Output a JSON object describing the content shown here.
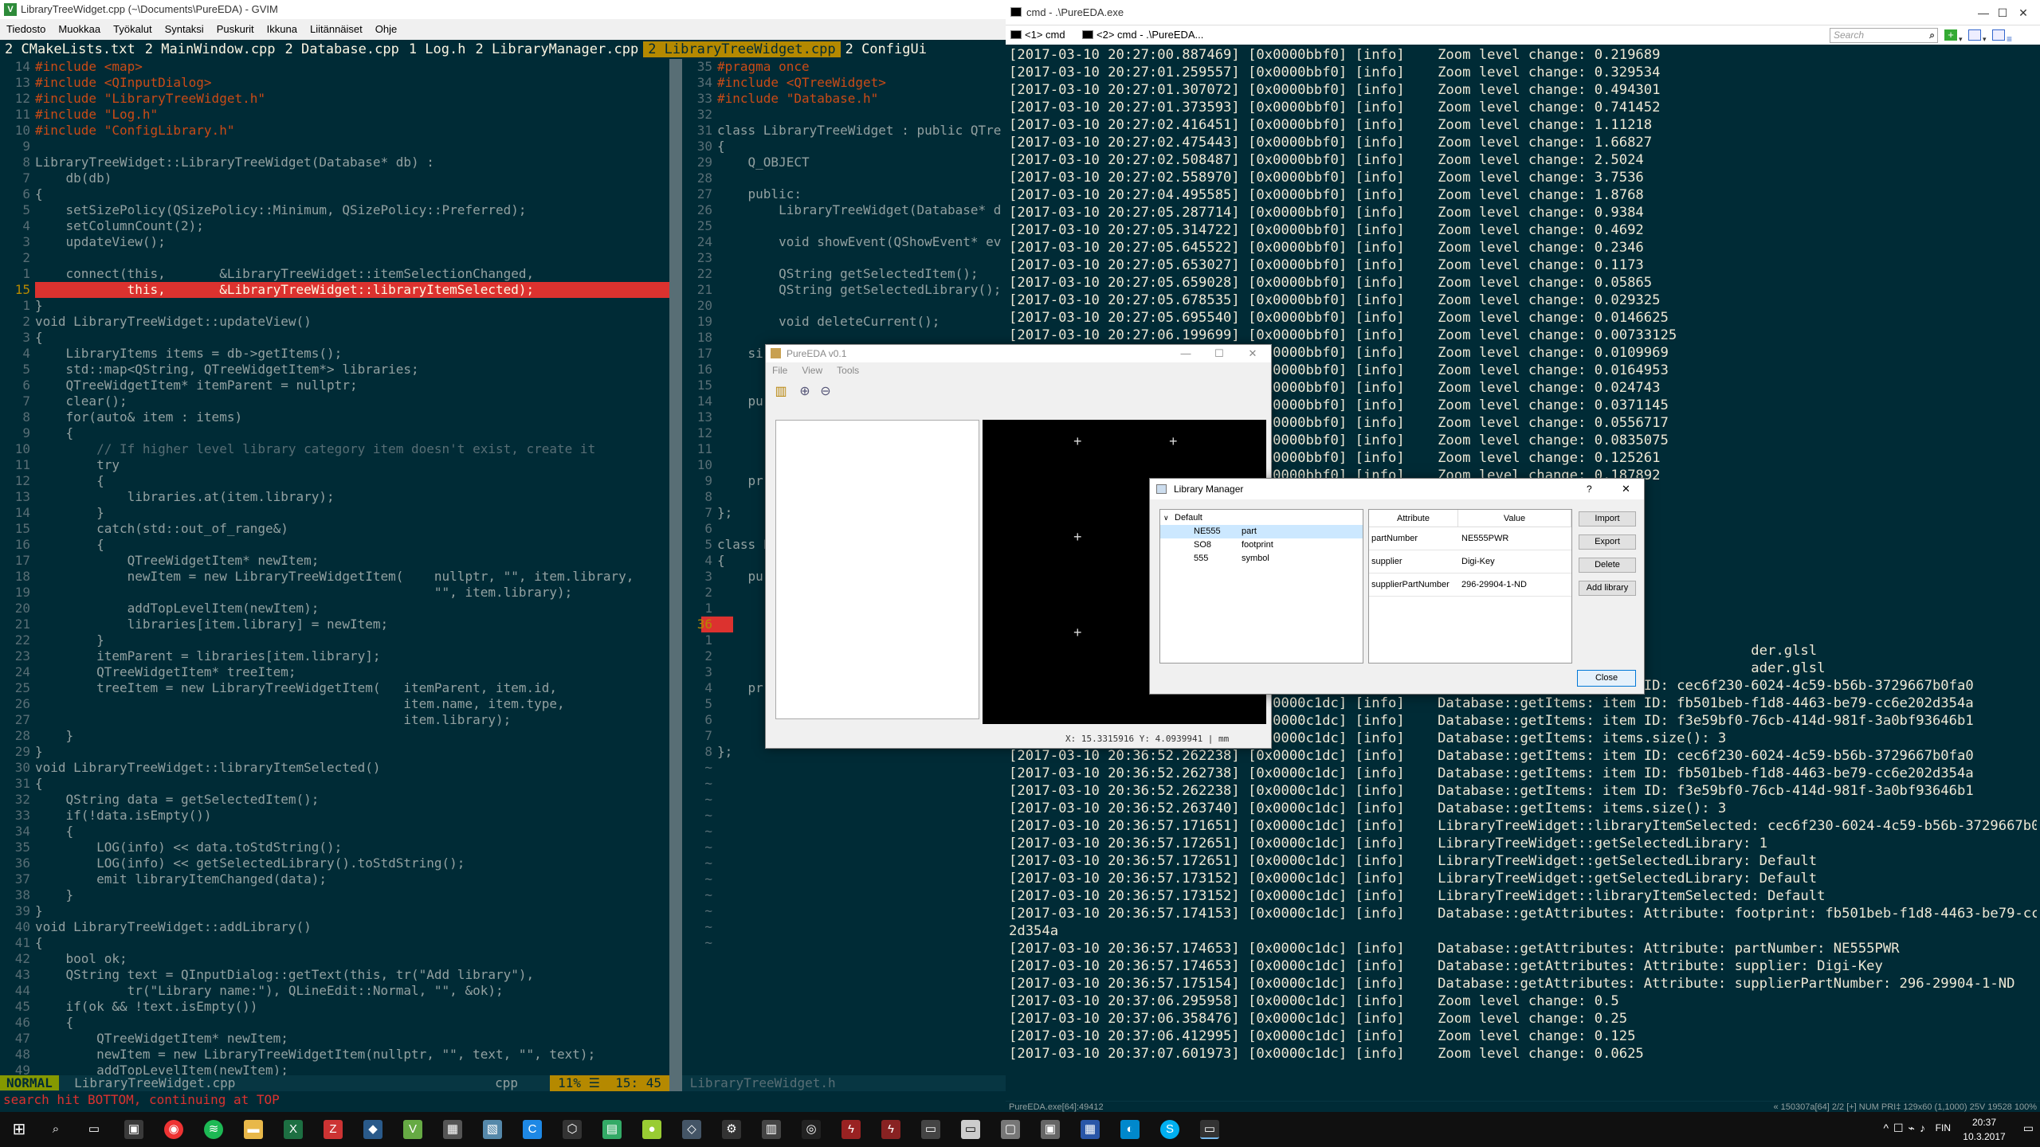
{
  "gvim": {
    "title": "LibraryTreeWidget.cpp (~\\Documents\\PureEDA) - GVIM",
    "menu": [
      "Tiedosto",
      "Muokkaa",
      "Työkalut",
      "Syntaksi",
      "Puskurit",
      "Ikkuna",
      "Liitännäiset",
      "Ohje"
    ],
    "tabs": [
      {
        "label": "2 CMakeLists.txt",
        "active": false
      },
      {
        "label": "2 MainWindow.cpp",
        "active": false
      },
      {
        "label": "2 Database.cpp",
        "active": false
      },
      {
        "label": "1 Log.h",
        "active": false
      },
      {
        "label": "2 LibraryManager.cpp",
        "active": false
      },
      {
        "label": "2 LibraryTreeWidget.cpp",
        "active": true
      },
      {
        "label": "2 ConfigUi",
        "active": false
      }
    ],
    "left_lines": [
      {
        "n": "14",
        "t": "#include <map>"
      },
      {
        "n": "13",
        "t": "#include <QInputDialog>"
      },
      {
        "n": "12",
        "t": "#include \"LibraryTreeWidget.h\""
      },
      {
        "n": "11",
        "t": "#include \"Log.h\""
      },
      {
        "n": "10",
        "t": "#include \"ConfigLibrary.h\""
      },
      {
        "n": "9",
        "t": ""
      },
      {
        "n": "8",
        "t": "LibraryTreeWidget::LibraryTreeWidget(Database* db) :"
      },
      {
        "n": "7",
        "t": "    db(db)"
      },
      {
        "n": "6",
        "t": "{"
      },
      {
        "n": "5",
        "t": "    setSizePolicy(QSizePolicy::Minimum, QSizePolicy::Preferred);"
      },
      {
        "n": "4",
        "t": "    setColumnCount(2);"
      },
      {
        "n": "3",
        "t": "    updateView();"
      },
      {
        "n": "2",
        "t": ""
      },
      {
        "n": "1",
        "t": "    connect(this,       &LibraryTreeWidget::itemSelectionChanged,"
      },
      {
        "n": "15",
        "t": "            this,       &LibraryTreeWidget::libraryItemSelected);",
        "hl": true
      },
      {
        "n": "1",
        "t": "}"
      },
      {
        "n": "2",
        "t": "void LibraryTreeWidget::updateView()"
      },
      {
        "n": "3",
        "t": "{"
      },
      {
        "n": "4",
        "t": "    LibraryItems items = db->getItems();"
      },
      {
        "n": "5",
        "t": "    std::map<QString, QTreeWidgetItem*> libraries;"
      },
      {
        "n": "6",
        "t": "    QTreeWidgetItem* itemParent = nullptr;"
      },
      {
        "n": "7",
        "t": "    clear();"
      },
      {
        "n": "8",
        "t": "    for(auto& item : items)"
      },
      {
        "n": "9",
        "t": "    {"
      },
      {
        "n": "10",
        "t": "        // If higher level library category item doesn't exist, create it"
      },
      {
        "n": "11",
        "t": "        try"
      },
      {
        "n": "12",
        "t": "        {"
      },
      {
        "n": "13",
        "t": "            libraries.at(item.library);"
      },
      {
        "n": "14",
        "t": "        }"
      },
      {
        "n": "15",
        "t": "        catch(std::out_of_range&)"
      },
      {
        "n": "16",
        "t": "        {"
      },
      {
        "n": "17",
        "t": "            QTreeWidgetItem* newItem;"
      },
      {
        "n": "18",
        "t": "            newItem = new LibraryTreeWidgetItem(    nullptr, \"\", item.library,"
      },
      {
        "n": "19",
        "t": "                                                    \"\", item.library);"
      },
      {
        "n": "20",
        "t": "            addTopLevelItem(newItem);"
      },
      {
        "n": "21",
        "t": "            libraries[item.library] = newItem;"
      },
      {
        "n": "22",
        "t": "        }"
      },
      {
        "n": "23",
        "t": "        itemParent = libraries[item.library];"
      },
      {
        "n": "24",
        "t": "        QTreeWidgetItem* treeItem;"
      },
      {
        "n": "25",
        "t": "        treeItem = new LibraryTreeWidgetItem(   itemParent, item.id,"
      },
      {
        "n": "26",
        "t": "                                                item.name, item.type,"
      },
      {
        "n": "27",
        "t": "                                                item.library);"
      },
      {
        "n": "28",
        "t": "    }"
      },
      {
        "n": "29",
        "t": "}"
      },
      {
        "n": "30",
        "t": "void LibraryTreeWidget::libraryItemSelected()"
      },
      {
        "n": "31",
        "t": "{"
      },
      {
        "n": "32",
        "t": "    QString data = getSelectedItem();"
      },
      {
        "n": "33",
        "t": "    if(!data.isEmpty())"
      },
      {
        "n": "34",
        "t": "    {"
      },
      {
        "n": "35",
        "t": "        LOG(info) << data.toStdString();"
      },
      {
        "n": "36",
        "t": "        LOG(info) << getSelectedLibrary().toStdString();"
      },
      {
        "n": "37",
        "t": "        emit libraryItemChanged(data);"
      },
      {
        "n": "38",
        "t": "    }"
      },
      {
        "n": "39",
        "t": "}"
      },
      {
        "n": "40",
        "t": "void LibraryTreeWidget::addLibrary()"
      },
      {
        "n": "41",
        "t": "{"
      },
      {
        "n": "42",
        "t": "    bool ok;"
      },
      {
        "n": "43",
        "t": "    QString text = QInputDialog::getText(this, tr(\"Add library\"),"
      },
      {
        "n": "44",
        "t": "            tr(\"Library name:\"), QLineEdit::Normal, \"\", &ok);"
      },
      {
        "n": "45",
        "t": "    if(ok && !text.isEmpty())"
      },
      {
        "n": "46",
        "t": "    {"
      },
      {
        "n": "47",
        "t": "        QTreeWidgetItem* newItem;"
      },
      {
        "n": "48",
        "t": "        newItem = new LibraryTreeWidgetItem(nullptr, \"\", text, \"\", text);"
      },
      {
        "n": "49",
        "t": "        addTopLevelItem(newItem);"
      }
    ],
    "right_lines": [
      {
        "n": "35",
        "t": "#pragma once"
      },
      {
        "n": "34",
        "t": "#include <QTreeWidget>"
      },
      {
        "n": "33",
        "t": "#include \"Database.h\""
      },
      {
        "n": "32",
        "t": ""
      },
      {
        "n": "31",
        "t": "class LibraryTreeWidget : public QTre"
      },
      {
        "n": "30",
        "t": "{"
      },
      {
        "n": "29",
        "t": "    Q_OBJECT"
      },
      {
        "n": "28",
        "t": ""
      },
      {
        "n": "27",
        "t": "    public:"
      },
      {
        "n": "26",
        "t": "        LibraryTreeWidget(Database* d"
      },
      {
        "n": "25",
        "t": ""
      },
      {
        "n": "24",
        "t": "        void showEvent(QShowEvent* ev"
      },
      {
        "n": "23",
        "t": ""
      },
      {
        "n": "22",
        "t": "        QString getSelectedItem();"
      },
      {
        "n": "21",
        "t": "        QString getSelectedLibrary();"
      },
      {
        "n": "20",
        "t": ""
      },
      {
        "n": "19",
        "t": "        void deleteCurrent();"
      },
      {
        "n": "18",
        "t": ""
      },
      {
        "n": "17",
        "t": "    si"
      },
      {
        "n": "16",
        "t": ""
      },
      {
        "n": "15",
        "t": ""
      },
      {
        "n": "14",
        "t": "    pu"
      },
      {
        "n": "13",
        "t": ""
      },
      {
        "n": "12",
        "t": ""
      },
      {
        "n": "11",
        "t": ""
      },
      {
        "n": "10",
        "t": ""
      },
      {
        "n": "9",
        "t": "    pr"
      },
      {
        "n": "8",
        "t": ""
      },
      {
        "n": "7",
        "t": "};"
      },
      {
        "n": "6",
        "t": ""
      },
      {
        "n": "5",
        "t": "class L"
      },
      {
        "n": "4",
        "t": "{"
      },
      {
        "n": "3",
        "t": "    pu"
      },
      {
        "n": "2",
        "t": ""
      },
      {
        "n": "1",
        "t": ""
      },
      {
        "n": "36",
        "t": "",
        "hl": true
      },
      {
        "n": "1",
        "t": ""
      },
      {
        "n": "2",
        "t": ""
      },
      {
        "n": "3",
        "t": ""
      },
      {
        "n": "4",
        "t": "    pr"
      },
      {
        "n": "5",
        "t": ""
      },
      {
        "n": "6",
        "t": ""
      },
      {
        "n": "7",
        "t": ""
      },
      {
        "n": "8",
        "t": "};"
      },
      {
        "n": "~",
        "t": ""
      },
      {
        "n": "~",
        "t": ""
      },
      {
        "n": "~",
        "t": ""
      },
      {
        "n": "~",
        "t": ""
      },
      {
        "n": "~",
        "t": ""
      },
      {
        "n": "~",
        "t": ""
      },
      {
        "n": "~",
        "t": ""
      },
      {
        "n": "~",
        "t": ""
      },
      {
        "n": "~",
        "t": ""
      },
      {
        "n": "~",
        "t": ""
      },
      {
        "n": "~",
        "t": ""
      },
      {
        "n": "~",
        "t": ""
      }
    ],
    "status_mode": "NORMAL",
    "status_file": "LibraryTreeWidget.cpp",
    "status_ft": "cpp",
    "status_pos": "11% ☰  15: 45",
    "status_right_file": "LibraryTreeWidget.h",
    "cmdline": "search hit BOTTOM, continuing at TOP"
  },
  "cmd": {
    "title": "cmd - .\\PureEDA.exe",
    "tab1": "<1> cmd",
    "tab2": "<2> cmd - .\\PureEDA...",
    "search_placeholder": "Search",
    "log": [
      "[2017-03-10 20:27:00.887469] [0x0000bbf0] [info]    Zoom level change: 0.219689",
      "[2017-03-10 20:27:01.259557] [0x0000bbf0] [info]    Zoom level change: 0.329534",
      "[2017-03-10 20:27:01.307072] [0x0000bbf0] [info]    Zoom level change: 0.494301",
      "[2017-03-10 20:27:01.373593] [0x0000bbf0] [info]    Zoom level change: 0.741452",
      "[2017-03-10 20:27:02.416451] [0x0000bbf0] [info]    Zoom level change: 1.11218",
      "[2017-03-10 20:27:02.475443] [0x0000bbf0] [info]    Zoom level change: 1.66827",
      "[2017-03-10 20:27:02.508487] [0x0000bbf0] [info]    Zoom level change: 2.5024",
      "[2017-03-10 20:27:02.558970] [0x0000bbf0] [info]    Zoom level change: 3.7536",
      "[2017-03-10 20:27:04.495585] [0x0000bbf0] [info]    Zoom level change: 1.8768",
      "[2017-03-10 20:27:05.287714] [0x0000bbf0] [info]    Zoom level change: 0.9384",
      "[2017-03-10 20:27:05.314722] [0x0000bbf0] [info]    Zoom level change: 0.4692",
      "[2017-03-10 20:27:05.645522] [0x0000bbf0] [info]    Zoom level change: 0.2346",
      "[2017-03-10 20:27:05.653027] [0x0000bbf0] [info]    Zoom level change: 0.1173",
      "[2017-03-10 20:27:05.659028] [0x0000bbf0] [info]    Zoom level change: 0.05865",
      "[2017-03-10 20:27:05.678535] [0x0000bbf0] [info]    Zoom level change: 0.029325",
      "[2017-03-10 20:27:05.695540] [0x0000bbf0] [info]    Zoom level change: 0.0146625",
      "[2017-03-10 20:27:06.199699] [0x0000bbf0] [info]    Zoom level change: 0.00733125",
      "                              0x0000bbf0] [info]    Zoom level change: 0.0109969",
      "                              0x0000bbf0] [info]    Zoom level change: 0.0164953",
      "                              0x0000bbf0] [info]    Zoom level change: 0.024743",
      "                              0x0000bbf0] [info]    Zoom level change: 0.0371145",
      "                              0x0000bbf0] [info]    Zoom level change: 0.0556717",
      "                              0x0000bbf0] [info]    Zoom level change: 0.0835075",
      "                              0x0000bbf0] [info]    Zoom level change: 0.125261",
      "                              0x0000bbf0] [info]    Zoom level change: 0.187892",
      "",
      "",
      "",
      "",
      "",
      "",
      "",
      "",
      "",
      "                                                                                          der.glsl",
      "                                                                                          ader.glsl",
      "                              0x0000c1dc] [info]    Database::getItems: item ID: cec6f230-6024-4c59-b56b-3729667b0fa0",
      "                              0x0000c1dc] [info]    Database::getItems: item ID: fb501beb-f1d8-4463-be79-cc6e202d354a",
      "                              0x0000c1dc] [info]    Database::getItems: item ID: f3e59bf0-76cb-414d-981f-3a0bf93646b1",
      "[2017-03-10 20:36:52.233729] [0x0000c1dc] [info]    Database::getItems: items.size(): 3",
      "[2017-03-10 20:36:52.262238] [0x0000c1dc] [info]    Database::getItems: item ID: cec6f230-6024-4c59-b56b-3729667b0fa0",
      "[2017-03-10 20:36:52.262738] [0x0000c1dc] [info]    Database::getItems: item ID: fb501beb-f1d8-4463-be79-cc6e202d354a",
      "[2017-03-10 20:36:52.262238] [0x0000c1dc] [info]    Database::getItems: item ID: f3e59bf0-76cb-414d-981f-3a0bf93646b1",
      "[2017-03-10 20:36:52.263740] [0x0000c1dc] [info]    Database::getItems: items.size(): 3",
      "[2017-03-10 20:36:57.171651] [0x0000c1dc] [info]    LibraryTreeWidget::libraryItemSelected: cec6f230-6024-4c59-b56b-3729667b0fa0",
      "[2017-03-10 20:36:57.172651] [0x0000c1dc] [info]    LibraryTreeWidget::getSelectedLibrary: 1",
      "[2017-03-10 20:36:57.172651] [0x0000c1dc] [info]    LibraryTreeWidget::getSelectedLibrary: Default",
      "[2017-03-10 20:36:57.173152] [0x0000c1dc] [info]    LibraryTreeWidget::getSelectedLibrary: Default",
      "[2017-03-10 20:36:57.173152] [0x0000c1dc] [info]    LibraryTreeWidget::libraryItemSelected: Default",
      "[2017-03-10 20:36:57.174153] [0x0000c1dc] [info]    Database::getAttributes: Attribute: footprint: fb501beb-f1d8-4463-be79-cc6e20",
      "2d354a",
      "[2017-03-10 20:36:57.174653] [0x0000c1dc] [info]    Database::getAttributes: Attribute: partNumber: NE555PWR",
      "[2017-03-10 20:36:57.174653] [0x0000c1dc] [info]    Database::getAttributes: Attribute: supplier: Digi-Key",
      "[2017-03-10 20:36:57.175154] [0x0000c1dc] [info]    Database::getAttributes: Attribute: supplierPartNumber: 296-29904-1-ND",
      "[2017-03-10 20:37:06.295958] [0x0000c1dc] [info]    Zoom level change: 0.5",
      "[2017-03-10 20:37:06.358476] [0x0000c1dc] [info]    Zoom level change: 0.25",
      "[2017-03-10 20:37:06.412995] [0x0000c1dc] [info]    Zoom level change: 0.125",
      "[2017-03-10 20:37:07.601973] [0x0000c1dc] [info]    Zoom level change: 0.0625"
    ],
    "status_left": "PureEDA.exe[64]:49412",
    "status_right": "« 150307a[64]  2/2  [+] NUM  PRI‡  129x60  (1,1000) 25V  19528 100%"
  },
  "pureeda": {
    "title": "PureEDA v0.1",
    "menu": [
      "File",
      "View",
      "Tools"
    ],
    "status": "X:    15.3315916  Y:      4.0939941  |  mm"
  },
  "libmgr": {
    "title": "Library Manager",
    "help": "?",
    "close_x": "✕",
    "tree_root": "Default",
    "tree_items": [
      {
        "name": "NE555",
        "type": "part",
        "selected": true
      },
      {
        "name": "SO8",
        "type": "footprint",
        "selected": false
      },
      {
        "name": "555",
        "type": "symbol",
        "selected": false
      }
    ],
    "attr_header": "Attribute",
    "value_header": "Value",
    "attrs": [
      {
        "a": "partNumber",
        "v": "NE555PWR"
      },
      {
        "a": "supplier",
        "v": "Digi-Key"
      },
      {
        "a": "supplierPartNumber",
        "v": "296-29904-1-ND"
      }
    ],
    "buttons": [
      "Import",
      "Export",
      "Delete",
      "Add library"
    ],
    "close_label": "Close"
  },
  "taskbar": {
    "time": "20:37",
    "date": "10.3.2017",
    "lang": "FIN"
  },
  "colors": {
    "accent": "#b58900",
    "bg": "#002b36",
    "error": "#dc322f"
  }
}
